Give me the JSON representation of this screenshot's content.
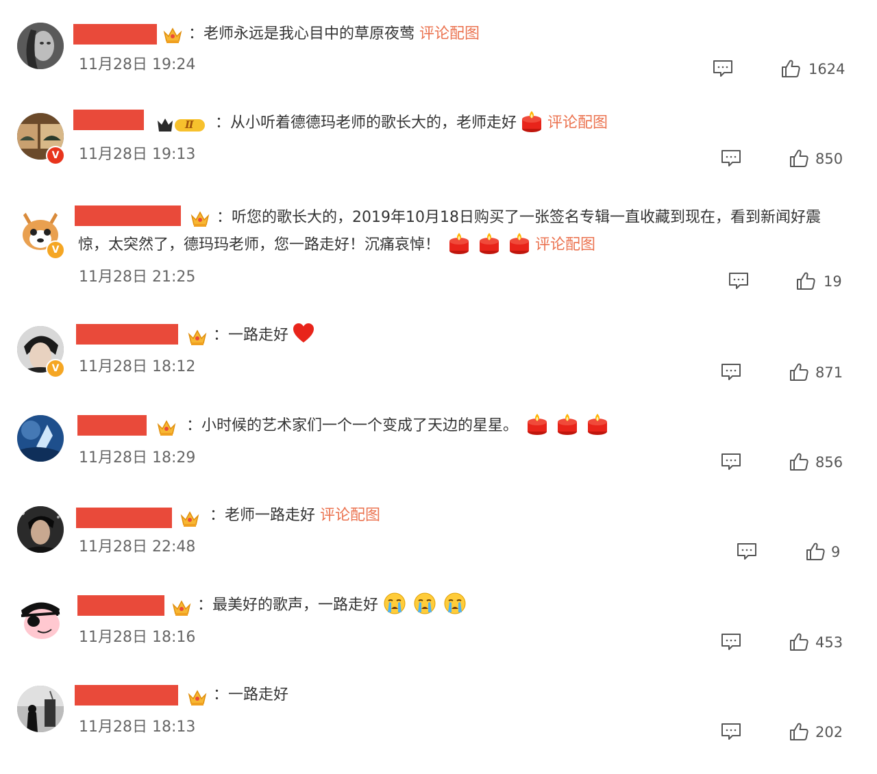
{
  "comments": [
    {
      "text": "：老师永远是我心目中的草原夜莺",
      "link": "评论配图",
      "time": "11月28日 19:24",
      "likes": "1624"
    },
    {
      "text": "：从小听着德德玛老师的歌长大的，老师走好",
      "link": "评论配图",
      "time": "11月28日 19:13",
      "likes": "850"
    },
    {
      "text": "：听您的歌长大的，2019年10月18日购买了一张签名专辑一直收藏到现在，看到新闻好震惊，太突然了，德玛玛老师，您一路走好！沉痛哀悼！",
      "link": "评论配图",
      "time": "11月28日 21:25",
      "likes": "19"
    },
    {
      "text": "：一路走好",
      "link": "",
      "time": "11月28日 18:12",
      "likes": "871"
    },
    {
      "text": "：小时候的艺术家们一个一个变成了天边的星星。",
      "link": "",
      "time": "11月28日 18:29",
      "likes": "856"
    },
    {
      "text": "：老师一路走好",
      "link": "评论配图",
      "time": "11月28日 22:48",
      "likes": "9"
    },
    {
      "text": "：最美好的歌声，一路走好",
      "link": "",
      "time": "11月28日 18:16",
      "likes": "453"
    },
    {
      "text": "：一路走好",
      "link": "",
      "time": "11月28日 18:13",
      "likes": "202"
    }
  ],
  "badges": {
    "vip_level": "Ⅱ",
    "verified": "V"
  },
  "icons": {
    "comment": "comment-icon",
    "like": "thumbs-up-icon",
    "candle": "candle-emoji",
    "heart": "heart-emoji",
    "crying": "crying-face-emoji"
  },
  "colors": {
    "link": "#eb7350",
    "redaction": "#e94a3a",
    "text": "#333333",
    "meta": "#666666"
  }
}
